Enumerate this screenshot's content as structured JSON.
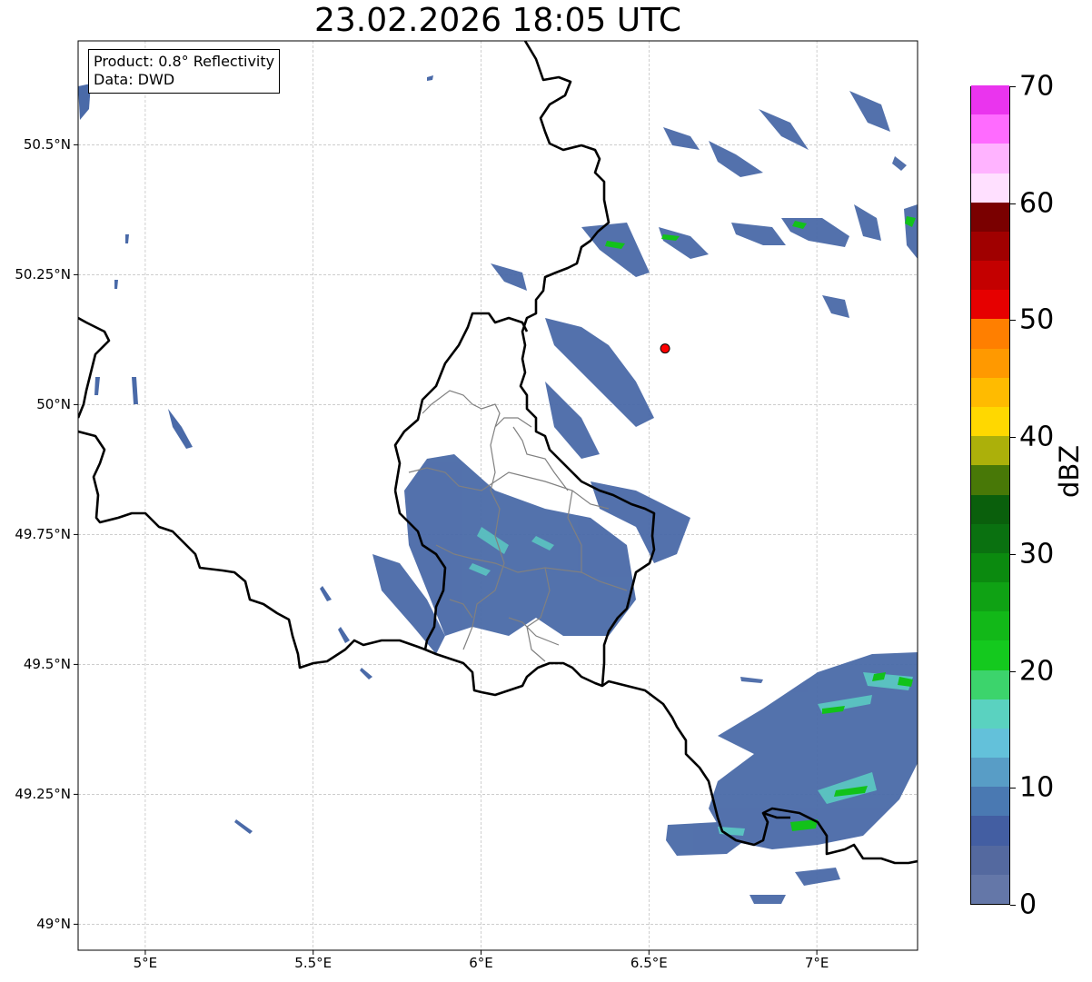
{
  "title": "23.02.2026 18:05 UTC",
  "info": {
    "product_line": "Product: 0.8° Reflectivity",
    "data_line": "Data: DWD"
  },
  "map": {
    "lon_range": [
      4.8,
      7.3
    ],
    "lat_range": [
      48.95,
      50.7
    ],
    "lat_ticks": [
      {
        "value": 49.0,
        "label": "49°N"
      },
      {
        "value": 49.25,
        "label": "49.25°N"
      },
      {
        "value": 49.5,
        "label": "49.5°N"
      },
      {
        "value": 49.75,
        "label": "49.75°N"
      },
      {
        "value": 50.0,
        "label": "50°N"
      },
      {
        "value": 50.25,
        "label": "50.25°N"
      },
      {
        "value": 50.5,
        "label": "50.5°N"
      }
    ],
    "lon_ticks": [
      {
        "value": 5.0,
        "label": "5°E"
      },
      {
        "value": 5.5,
        "label": "5.5°E"
      },
      {
        "value": 6.0,
        "label": "6°E"
      },
      {
        "value": 6.5,
        "label": "6.5°E"
      },
      {
        "value": 7.0,
        "label": "7°E"
      }
    ],
    "grid": true,
    "marker": {
      "lon": 6.548,
      "lat": 50.108,
      "color": "#ff0000"
    },
    "echo_colors": {
      "low": "#4a6aa8",
      "mid": "#5a8cc0",
      "cyan": "#5ccfc4",
      "green": "#12c21a"
    }
  },
  "colorbar": {
    "label": "dBZ",
    "range": [
      0,
      70
    ],
    "ticks": [
      0,
      10,
      20,
      30,
      40,
      50,
      60,
      70
    ],
    "tick_labels": [
      "0",
      "10",
      "20",
      "30",
      "40",
      "50",
      "60",
      "70"
    ],
    "colors": [
      "#6477a8",
      "#54699f",
      "#435ea2",
      "#4a79b2",
      "#589dc6",
      "#63c1da",
      "#5ad2c0",
      "#3cd46c",
      "#14c91e",
      "#12b818",
      "#0fa214",
      "#0b8a0f",
      "#0a7110",
      "#0a5f0c",
      "#487807",
      "#acb00a",
      "#ffd800",
      "#ffbb00",
      "#ff9900",
      "#ff7f00",
      "#e60000",
      "#c40000",
      "#a00000",
      "#7a0000",
      "#ffe0ff",
      "#ffb3ff",
      "#ff6bff",
      "#ea34ee"
    ]
  }
}
